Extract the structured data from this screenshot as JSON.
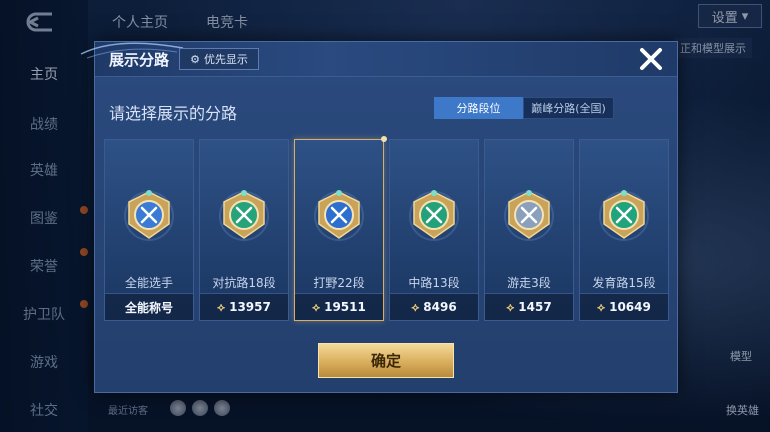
{
  "background": {
    "sidebar_items": [
      "主页",
      "战绩",
      "英雄",
      "图鉴",
      "荣誉",
      "护卫队",
      "游戏",
      "社交"
    ],
    "active_item": "主页",
    "top_tabs": [
      "个人主页",
      "电竞卡"
    ],
    "settings_label": "设置",
    "promo_text": "正和模型展示",
    "bottom_right": [
      "模型",
      "换英雄"
    ],
    "visitors_label": "最近访客"
  },
  "modal": {
    "title": "展示分路",
    "priority_label": "优先显示",
    "subtitle": "请选择展示的分路",
    "toggle": {
      "active": "分路段位",
      "inactive": "巅峰分路(全国)"
    },
    "confirm_label": "确定",
    "cards": [
      {
        "rank": "全能选手",
        "footer": "全能称号",
        "has_coin": false,
        "emblem": "all-round-emblem-icon",
        "color": "#3a7bd5"
      },
      {
        "rank": "对抗路18段",
        "footer": "13957",
        "has_coin": true,
        "emblem": "clash-lane-emblem-icon",
        "color": "#27a37a"
      },
      {
        "rank": "打野22段",
        "footer": "19511",
        "has_coin": true,
        "emblem": "jungle-emblem-icon",
        "color": "#2d6fd1"
      },
      {
        "rank": "中路13段",
        "footer": "8496",
        "has_coin": true,
        "emblem": "mid-lane-emblem-icon",
        "color": "#23a27a"
      },
      {
        "rank": "游走3段",
        "footer": "1457",
        "has_coin": true,
        "emblem": "roam-emblem-icon",
        "color": "#8aa0bd"
      },
      {
        "rank": "发育路15段",
        "footer": "10649",
        "has_coin": true,
        "emblem": "farm-lane-emblem-icon",
        "color": "#21a37c"
      }
    ],
    "selected_index": 2
  },
  "colors": {
    "accent_gold": "#d6b06a",
    "toggle_active": "#3d78c9"
  }
}
